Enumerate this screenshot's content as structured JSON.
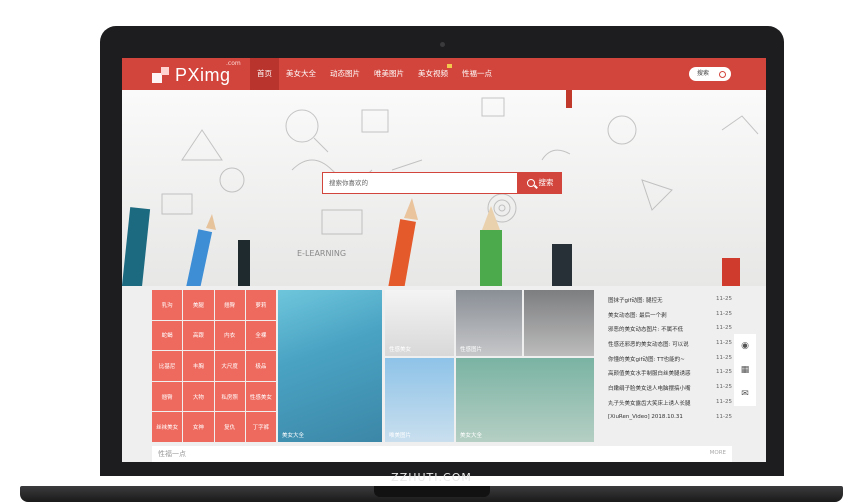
{
  "site": {
    "logo_text": "PXimg",
    "logo_sup": ".com",
    "nav": [
      {
        "label": "首页",
        "active": true
      },
      {
        "label": "美女大全"
      },
      {
        "label": "动态图片"
      },
      {
        "label": "唯美图片"
      },
      {
        "label": "美女视频",
        "hot": true
      },
      {
        "label": "性福一点"
      }
    ],
    "search_pill": "搜索"
  },
  "hero": {
    "search_placeholder": "搜索你喜欢的",
    "search_button": "搜索",
    "sketch_text": "E-LEARNING"
  },
  "tags": [
    "乳沟",
    "美腿",
    "翘臀",
    "萝莉",
    "蛇蝎",
    "高跟",
    "内衣",
    "全裸",
    "比基尼",
    "丰胸",
    "大尺度",
    "极品",
    "翘臀",
    "大物",
    "私房照",
    "性感美女",
    "丝袜美女",
    "女神",
    "复仇",
    "丁字裤"
  ],
  "tiles": [
    {
      "id": "t1",
      "caption": "美女大全"
    },
    {
      "id": "t2",
      "caption": "性感美女"
    },
    {
      "id": "t3",
      "caption": "性感图片"
    },
    {
      "id": "t4",
      "caption": ""
    },
    {
      "id": "t5",
      "caption": "唯美图片"
    },
    {
      "id": "t6",
      "caption": "美女大全"
    }
  ],
  "news": [
    {
      "title": "图抹子gif动图: 腿控无",
      "date": "11-25"
    },
    {
      "title": "美女动态图: 最后一个剥",
      "date": "11-25"
    },
    {
      "title": "邪恶的美女动态图片: 不属不低",
      "date": "11-25"
    },
    {
      "title": "性感还邪恶的美女动态图: 可以说",
      "date": "11-25"
    },
    {
      "title": "你懂的美女gif动图: TT也能的~",
      "date": "11-25"
    },
    {
      "title": "高颜值美女水手制服白丝美腿诱惑",
      "date": "11-25"
    },
    {
      "title": "白嫩绢子脸美女送人电脑摆搞小嘴",
      "date": "11-25"
    },
    {
      "title": "丸子头美女露齿大笑床上诱人长腿",
      "date": "11-25"
    },
    {
      "title": "[XiuRen_Video] 2018.10.31",
      "date": "11-25"
    }
  ],
  "share_icons": [
    "rss-icon",
    "qrcode-icon",
    "mail-icon"
  ],
  "section": {
    "label": "性福一点",
    "more": "MORE"
  },
  "watermark": "ZZHUTI.COM",
  "colors": {
    "brand": "#d2453c",
    "tag": "#ee6a5e"
  }
}
